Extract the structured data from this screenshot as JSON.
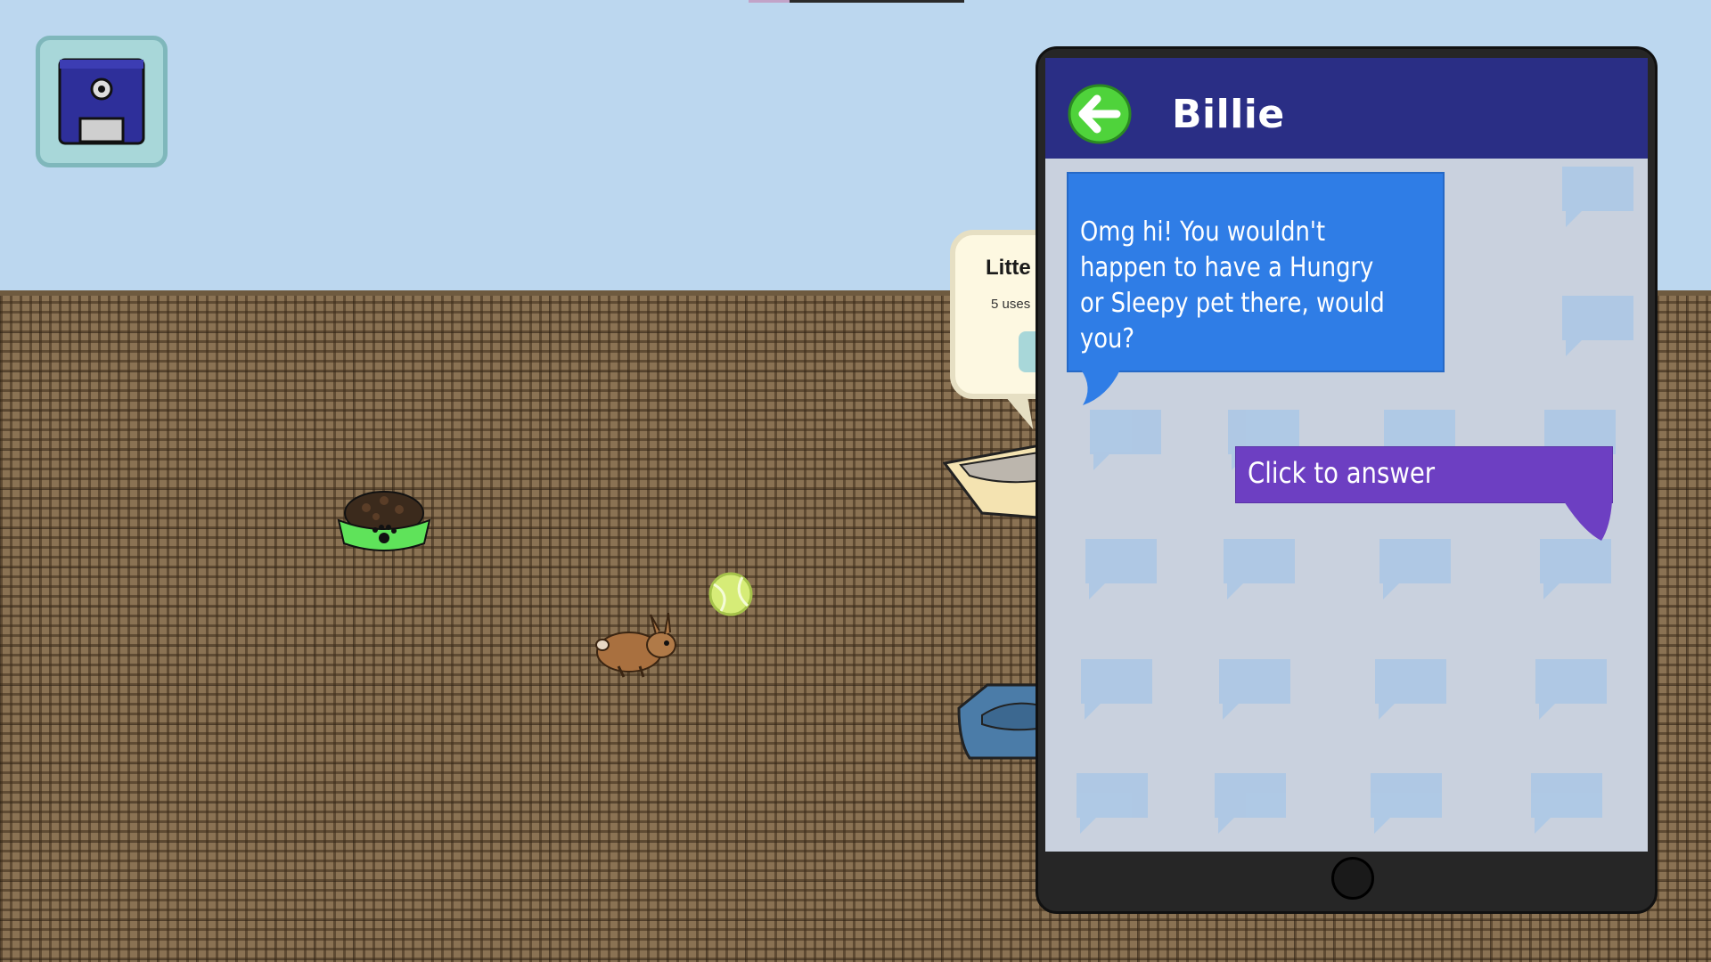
{
  "conversation": {
    "contact_name": "Billie",
    "incoming_message": "Omg hi! You wouldn't happen to have a Hungry or Sleepy pet there, would you?",
    "answer_prompt": "Click to answer"
  },
  "item_tooltip": {
    "title": "Litte",
    "uses": "5 uses"
  },
  "icons": {
    "save": "floppy-disk-icon",
    "back": "arrow-left-icon"
  },
  "colors": {
    "sky": "#bcd7ef",
    "phone_header": "#2a2e85",
    "incoming_bubble": "#2f7de6",
    "answer_bubble": "#6d3fc2",
    "back_button": "#4fd33b"
  }
}
